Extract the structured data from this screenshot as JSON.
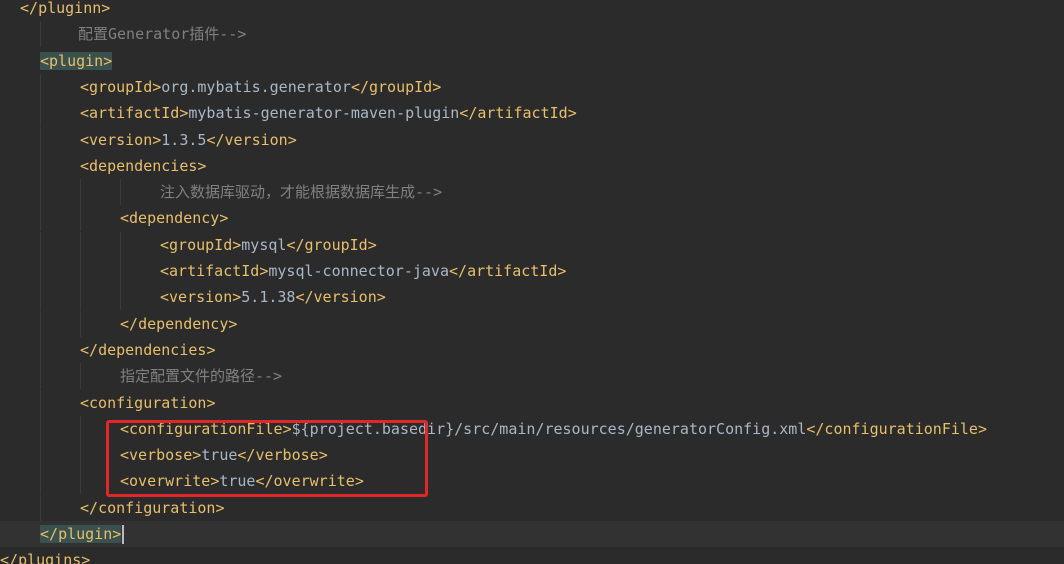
{
  "editor": {
    "lines": [
      {
        "kind": "tag",
        "open": "</",
        "name": "pluginn",
        "close": ">",
        "cut": true
      },
      {
        "kind": "comment",
        "text": "配置Generator插件-->"
      },
      {
        "kind": "tag",
        "open": "<",
        "name": "plugin",
        "close": ">"
      },
      {
        "kind": "element",
        "tag": "groupId",
        "value": "org.mybatis.generator"
      },
      {
        "kind": "element",
        "tag": "artifactId",
        "value": "mybatis-generator-maven-plugin"
      },
      {
        "kind": "element",
        "tag": "version",
        "value": "1.3.5"
      },
      {
        "kind": "tag",
        "open": "<",
        "name": "dependencies",
        "close": ">"
      },
      {
        "kind": "comment",
        "text": "注入数据库驱动，才能根据数据库生成-->"
      },
      {
        "kind": "tag",
        "open": "<",
        "name": "dependency",
        "close": ">"
      },
      {
        "kind": "element",
        "tag": "groupId",
        "value": "mysql"
      },
      {
        "kind": "element",
        "tag": "artifactId",
        "value": "mysql-connector-java"
      },
      {
        "kind": "element",
        "tag": "version",
        "value": "5.1.38"
      },
      {
        "kind": "tag",
        "open": "</",
        "name": "dependency",
        "close": ">"
      },
      {
        "kind": "tag",
        "open": "</",
        "name": "dependencies",
        "close": ">"
      },
      {
        "kind": "comment",
        "text": "指定配置文件的路径-->"
      },
      {
        "kind": "tag",
        "open": "<",
        "name": "configuration",
        "close": ">"
      },
      {
        "kind": "element",
        "tag": "configurationFile",
        "value": "${project.basedir}/src/main/resources/generatorConfig.xml"
      },
      {
        "kind": "element",
        "tag": "verbose",
        "value": "true"
      },
      {
        "kind": "element",
        "tag": "overwrite",
        "value": "true"
      },
      {
        "kind": "tag",
        "open": "</",
        "name": "configuration",
        "close": ">"
      },
      {
        "kind": "tag",
        "open": "</",
        "name": "plugin",
        "close": ">"
      },
      {
        "kind": "tag",
        "open": "</",
        "name": "plugins",
        "close": ">"
      }
    ]
  },
  "annotation": {
    "color": "#e0272a",
    "marks": "verbose and overwrite lines"
  },
  "colors": {
    "background": "#2b2b2b",
    "current_line": "#323232",
    "tag": "#e8bf6a",
    "text": "#a9b7c6",
    "comment": "#808080",
    "tag_highlight": "#3b514d"
  }
}
